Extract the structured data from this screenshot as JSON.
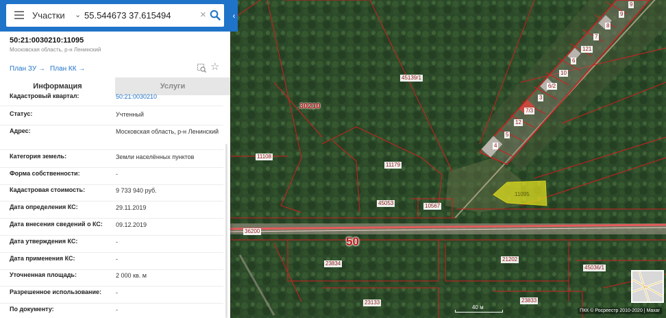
{
  "search": {
    "type_label": "Участки",
    "value": "55.544673 37.615494",
    "placeholder": ""
  },
  "object": {
    "cadastral_number": "50:21:0030210:11095",
    "address_short": "Московская область, р-н Ленинский",
    "plan_zu": "План ЗУ →",
    "plan_kk": "План КК →"
  },
  "tabs": {
    "info": "Информация",
    "services": "Услуги"
  },
  "info_rows": [
    {
      "label": "Кадастровый квартал:",
      "value": "50:21:0030210"
    },
    {
      "label": "Статус:",
      "value": "Учтенный"
    },
    {
      "label": "Адрес:",
      "value": "Московская область, р-н Ленинский"
    },
    {
      "label": "Категория земель:",
      "value": "Земли населённых пунктов"
    },
    {
      "label": "Форма собственности:",
      "value": "-"
    },
    {
      "label": "Кадастровая стоимость:",
      "value": "9 733 940 руб."
    },
    {
      "label": "Дата определения КС:",
      "value": "29.11.2019"
    },
    {
      "label": "Дата внесения сведений о КС:",
      "value": "09.12.2019"
    },
    {
      "label": "Дата утверждения КС:",
      "value": "-"
    },
    {
      "label": "Дата применения КС:",
      "value": "-"
    },
    {
      "label": "Уточненная площадь:",
      "value": "2 000 кв. м"
    },
    {
      "label": "Разрешенное использование:",
      "value": "-"
    },
    {
      "label": "По документу:",
      "value": "-"
    }
  ],
  "map": {
    "quarter": "30210",
    "road": "50",
    "selected_parcel": "11095",
    "parcel_labels": [
      "45139/1",
      "11108",
      "11179",
      "45053",
      "10567",
      "36200",
      "23834",
      "21202",
      "45036/1",
      "23133",
      "23833"
    ],
    "house_numbers": [
      "4",
      "5",
      "12",
      "7/3",
      "3",
      "6/2",
      "10",
      "6",
      "121",
      "7",
      "8",
      "9",
      "9"
    ],
    "scale": "40 м",
    "copyright": "ПКК © Росреестр 2010-2020 | Maxar"
  },
  "colors": {
    "accent": "#1f73c9",
    "boundary": "#d01f1f",
    "selected_fill": "#e8e51c"
  }
}
